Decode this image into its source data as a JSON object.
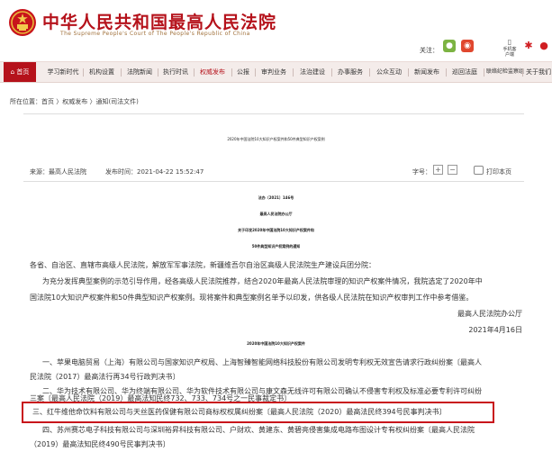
{
  "site": {
    "title": "中华人民共和国最高人民法院",
    "subtitle": "The Supreme People's Court of The People's Republic of China"
  },
  "follow": {
    "label": "关注：",
    "mobile_label": "手机客户端",
    "accent": "#b5121b"
  },
  "nav": {
    "items": [
      "首页",
      "学习新时代",
      "机构设置",
      "法院新闻",
      "执行时讯",
      "权威发布",
      "公报",
      "审判业务",
      "法治建设",
      "办事服务",
      "公众互动",
      "新闻发布",
      "巡回法庭",
      "联络纪检监察组",
      "关于我们"
    ]
  },
  "breadcrumb": "所在位置：首页 〉权威发布 〉通知(司法文件)",
  "article": {
    "title": "2020年中国法院10大知识产权案件和50件典型知识产权案例",
    "source": "来源：最高人民法院",
    "published": "发布时间：2021-04-22 15:52:47",
    "font_size_label": "字号：",
    "font_plus": "+",
    "font_minus": "−",
    "print_label": "打印本页",
    "doc_no": "法办〔2021〕146号",
    "issuer": "最高人民法院办公厅",
    "notice_title_1": "关于印发2020年中国法院10大知识产权案件和",
    "notice_title_2": "50件典型知识产权案例的通知",
    "recipients": "各省、自治区、直辖市高级人民法院，解放军军事法院，新疆维吾尔自治区高级人民法院生产建设兵团分院：",
    "body_1a": "为充分发挥典型案例的示范引导作用，经各高级人民法院推荐，结合2020年最高人民法院审理的知识产权案件情况，我院选定了2020年中",
    "body_1b": "国法院10大知识产权案件和50件典型知识产权案例。现将案件和典型案例名单予以印发，供各级人民法院在知识产权审判工作中参考借鉴。",
    "sign_org": "最高人民法院办公厅",
    "sign_date": "2021年4月16日",
    "list_heading": "2020年中国法院10大知识产权案件",
    "case_1a": "一、苹果电脑贸易（上海）有限公司与国家知识产权局、上海智臻智能网络科技股份有限公司发明专利权无效宣告请求行政纠纷案〔最高人",
    "case_1b": "民法院（2017）最高法行再34号行政判决书〕",
    "case_2a": "二、华为技术有限公司、华为终端有限公司、华为软件技术有限公司与康文森无线许可有限公司确认不侵害专利权及标准必要专利许可纠纷",
    "case_2b": "三案〔最高人民法院（2019）最高法知民终732、733、734号之一民事裁定书〕",
    "case_3": "三、红牛维他命饮料有限公司与天丝医药保健有限公司商标权权属纠纷案〔最高人民法院（2020）最高法民终394号民事判决书〕",
    "case_4a": "四、苏州赛芯电子科技有限公司与深圳裕昇科技有限公司、户财欢、黄建东、黄碧亮侵害集成电路布图设计专有权纠纷案〔最高人民法院",
    "case_4b": "（2019）最高法知民终490号民事判决书〕"
  }
}
